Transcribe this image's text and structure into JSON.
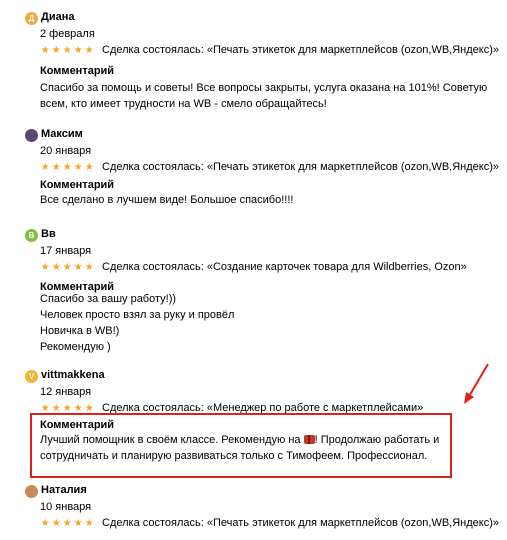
{
  "reviews": [
    {
      "avatar_letter": "Д",
      "avatar_color": "#f2a93b",
      "name": "Диана",
      "date": "2 февраля",
      "stars": [
        "★",
        "★",
        "★",
        "★",
        "★"
      ],
      "deal": "Сделка состоялась: «Печать этикеток для маркетплейсов (ozon,WB,Яндекс)»",
      "comment_heading": "Комментарий",
      "comment_lines": [
        "Спасибо за помощь и советы! Все вопросы закрыты, услуга оказана на 101%! Советую",
        "всем, кто имеет трудности на WB - смело обращайтесь!"
      ]
    },
    {
      "avatar_letter": "",
      "avatar_color": "#5a4a6e",
      "name": "Максим",
      "date": "20 января",
      "stars": [
        "★",
        "★",
        "★",
        "★",
        "★"
      ],
      "deal": "Сделка состоялась: «Печать этикеток для маркетплейсов (ozon,WB,Яндекс)»",
      "comment_heading": "Комментарий",
      "comment_lines": [
        "Все сделано в лучшем виде! Большое спасибо!!!!"
      ]
    },
    {
      "avatar_letter": "В",
      "avatar_color": "#7bc043",
      "name": "Вв",
      "date": "17 января",
      "stars": [
        "★",
        "★",
        "★",
        "★",
        "★"
      ],
      "deal": "Сделка состоялась: «Создание карточек товара для Wildberries, Ozon»",
      "comment_heading": "Комментарий",
      "comment_lines": [
        "Спасибо за вашу работу!))",
        "Человек просто взял за руку и провёл",
        "Новичка в WB!)",
        "Рекомендую )"
      ]
    },
    {
      "avatar_letter": "V",
      "avatar_color": "#f2b632",
      "name": "vittmakkena",
      "date": "12 января",
      "stars": [
        "★",
        "★",
        "★",
        "★",
        "★"
      ],
      "deal": "Сделка состоялась: «Менеджер по работе с маркетплейсами»",
      "comment_heading": "Комментарий",
      "comment_line1_before": "Лучший помощник в своём классе. Рекомендую на",
      "comment_line1_after": "! Продолжаю работать и",
      "comment_line2": "сотрудничать и планирую развиваться только с Тимофеем. Профессионал."
    },
    {
      "avatar_letter": "",
      "avatar_color": "#c98a5a",
      "name": "Наталия",
      "date": "10 января",
      "stars": [
        "★",
        "★",
        "★",
        "★",
        "★"
      ],
      "deal": "Сделка состоялась: «Печать этикеток для маркетплейсов (ozon,WB,Яндекс)»"
    }
  ],
  "accent_color": "#e0201c",
  "star_color": "#f5a623",
  "icons": {
    "star": "star-icon",
    "gift": "gift-emoji-icon",
    "arrow": "red-arrow-icon"
  }
}
